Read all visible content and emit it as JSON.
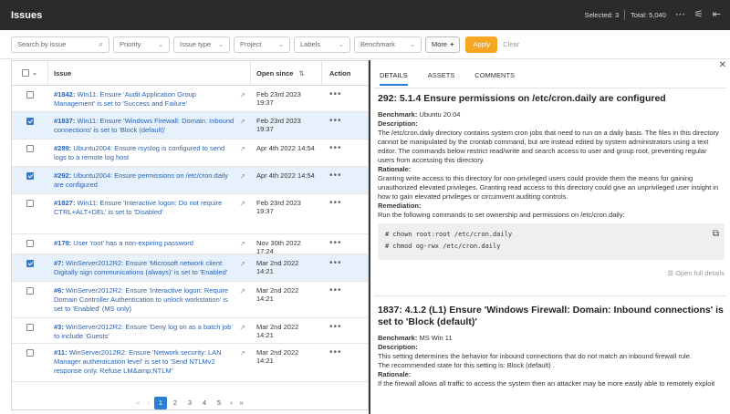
{
  "header": {
    "title": "Issues",
    "selected": "Selected: 3",
    "total": "Total: 5,040",
    "more_icon": "⋯",
    "filter_icon": "⚟",
    "collapse_icon": "⇤"
  },
  "filters": {
    "search_placeholder": "Search by issue",
    "dropdowns": [
      "Priority",
      "Issue type",
      "Project",
      "Labels",
      "Benchmark"
    ],
    "more_label": "More",
    "apply_label": "Apply",
    "clear_label": "Clear"
  },
  "table": {
    "columns": {
      "issue": "Issue",
      "open_since": "Open since",
      "action": "Action"
    },
    "rows": [
      {
        "id": "#1842:",
        "text": " Win11: Ensure 'Audit Application Group Management' is set to 'Success and Failure'",
        "date": "Feb 23rd 2023 19:37",
        "selected": false
      },
      {
        "id": "#1837:",
        "text": " Win11: Ensure 'Windows Firewall: Domain: Inbound connections' is set to 'Block (default)'",
        "date": "Feb 23rd 2023 19:37",
        "selected": true
      },
      {
        "id": "#289:",
        "text": " Ubuntu2004: Ensure rsyslog is configured to send logs to a remote log host",
        "date": "Apr 4th 2022 14:54",
        "selected": false
      },
      {
        "id": "#292:",
        "text": " Ubuntu2004: Ensure permissions on /etc/cron.daily are configured",
        "date": "Apr 4th 2022 14:54",
        "selected": true
      },
      {
        "id": "#1827:",
        "text": " Win11: Ensure 'Interactive logon: Do not require CTRL+ALT+DEL' is set to 'Disabled'",
        "date": "Feb 23rd 2023 19:37",
        "selected": false
      },
      {
        "id": "#179:",
        "text": " User 'root' has a non-expiring password",
        "date": "Nov 30th 2022 17:24",
        "selected": false
      },
      {
        "id": "#7:",
        "text": " WinServer2012R2: Ensure 'Microsoft network client: Digitally sign communications (always)' is set to 'Enabled'",
        "date": "Mar 2nd 2022 14:21",
        "selected": true
      },
      {
        "id": "#6:",
        "text": " WinServer2012R2: Ensure 'Interactive logon: Require Domain Controller Authentication to unlock workstation' is set to 'Enabled' (MS only)",
        "date": "Mar 2nd 2022 14:21",
        "selected": false
      },
      {
        "id": "#3:",
        "text": " WinServer2012R2: Ensure 'Deny log on as a batch job' to include 'Guests'",
        "date": "Mar 2nd 2022 14:21",
        "selected": false
      },
      {
        "id": "#11:",
        "text": " WinServer2012R2: Ensure 'Network security: LAN Manager authentication level' is set to 'Send NTLMv2 response only. Refuse LM&amp;NTLM'",
        "date": "Mar 2nd 2022 14:21",
        "selected": false
      }
    ]
  },
  "pagination": {
    "pages": [
      "1",
      "2",
      "3",
      "4",
      "5"
    ],
    "current": "1"
  },
  "panel": {
    "tabs": [
      "DETAILS",
      "ASSETS",
      "COMMENTS"
    ],
    "issue1": {
      "title": "292: 5.1.4 Ensure permissions on /etc/cron.daily are configured",
      "benchmark_label": "Benchmark:",
      "benchmark_value": " Ubuntu 20.04",
      "description_label": "Description:",
      "description": "The /etc/cron.daily directory contains system cron jobs that need to run on a daily basis. The files in this directory cannot be manipulated by the crontab command, but are instead edited by system administrators using a text editor. The commands below restrict read/write and search access to user and group root, preventing regular users from accessing this directory.",
      "rationale_label": "Rationale:",
      "rationale": "Granting write access to this directory for non-privileged users could provide them the means for gaining unauthorized elevated privileges. Granting read access to this directory could give an unprivileged user insight in how to gain elevated privileges or circumvent auditing controls.",
      "remediation_label": "Remediation:",
      "remediation": "Run the following commands to set ownership and permissions on /etc/cron.daily:",
      "code1": "# chown root:root /etc/cron.daily",
      "code2": "# chmod og-rwx /etc/cron.daily",
      "open_full": "Open full details"
    },
    "issue2": {
      "title": "1837: 4.1.2 (L1) Ensure 'Windows Firewall: Domain: Inbound connections' is set to 'Block (default)'",
      "benchmark_label": "Benchmark:",
      "benchmark_value": " MS Win 11",
      "description_label": "Description:",
      "description1": "This setting determines the behavior for inbound connections that do not match an inbound firewall rule.",
      "description2": "The recommended state for this setting is: Block (default) .",
      "rationale_label": "Rationale:",
      "rationale": "If the firewall allows all traffic to access the system then an attacker may be more easily able to remotely exploit"
    }
  }
}
